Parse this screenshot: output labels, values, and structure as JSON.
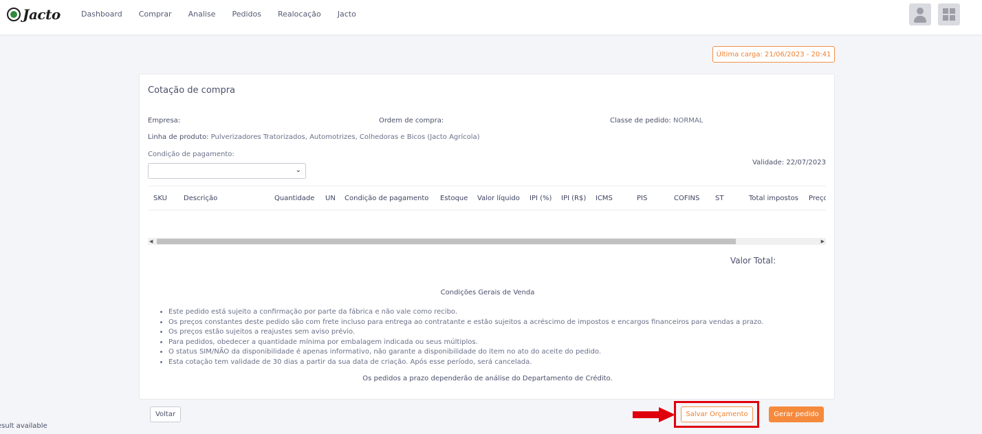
{
  "brand": {
    "name": "Jacto"
  },
  "nav": {
    "items": [
      "Dashboard",
      "Comprar",
      "Analise",
      "Pedidos",
      "Realocação",
      "Jacto"
    ]
  },
  "header_icons": [
    "user-avatar-icon",
    "apps-grid-icon"
  ],
  "last_load": "Última carga: 21/06/2023 - 20:41",
  "card": {
    "title": "Cotação de compra",
    "empresa": {
      "label": "Empresa:",
      "value": ""
    },
    "ordem": {
      "label": "Ordem de compra:",
      "value": ""
    },
    "classe": {
      "label": "Classe de pedido:",
      "value": "NORMAL"
    },
    "linha": {
      "label": "Linha de produto:",
      "value": "Pulverizadores Tratorizados, Automotrizes, Colhedoras e Bicos (Jacto Agrícola)"
    },
    "condicao_label": "Condição de pagamento:",
    "condicao_value": "",
    "validade": "Validade: 22/07/2023",
    "table_headers": [
      "SKU",
      "Descrição",
      "Quantidade",
      "UN",
      "Condição de pagamento",
      "Estoque",
      "Valor líquido",
      "IPI (%)",
      "IPI (R$)",
      "ICMS",
      "PIS",
      "COFINS",
      "ST",
      "Total impostos",
      "Preço"
    ],
    "valor_total_label": "Valor Total:",
    "cgv_title": "Condições Gerais de Venda",
    "cgv_items": [
      "Este pedido está sujeito a confirmação por parte da fábrica e não vale como recibo.",
      "Os preços constantes deste pedido são com frete incluso para entrega ao contratante e estão sujeitos a acréscimo de impostos e encargos financeiros para vendas a prazo.",
      "Os preços estão sujeitos a reajustes sem aviso prévio.",
      "Para pedidos, obedecer a quantidade mínima por embalagem indicada ou seus múltiplos.",
      "O status SIM/NÃO da disponibilidade é apenas informativo, não garante a disponibilidade do item no ato do aceite do pedido.",
      "Esta cotação tem validade de 30 dias a partir da sua data de criação. Após esse período, será cancelada."
    ],
    "cgv_footer": "Os pedidos a prazo dependerão de análise do Departamento de Crédito."
  },
  "buttons": {
    "voltar": "Voltar",
    "salvar": "Salvar Orçamento",
    "gerar": "Gerar pedido"
  },
  "status_text": "esult available",
  "colors": {
    "accent": "#f58a3c",
    "highlight": "#e0000d",
    "background": "#f4f5f8"
  }
}
